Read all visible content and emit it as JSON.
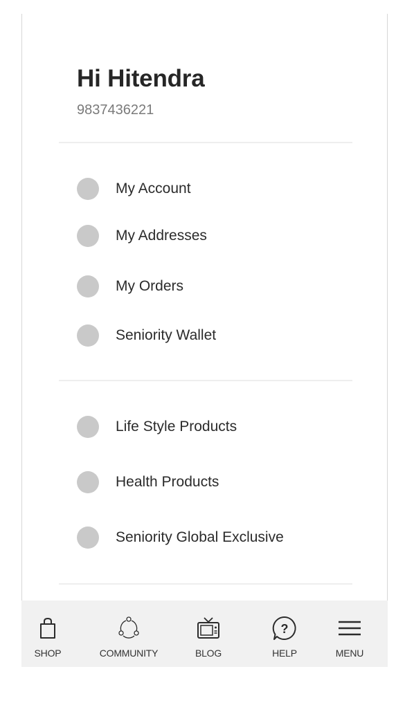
{
  "header": {
    "greeting": "Hi Hitendra",
    "phone": "9837436221"
  },
  "account_menu": [
    {
      "label": "My Account"
    },
    {
      "label": "My Addresses"
    },
    {
      "label": "My Orders"
    },
    {
      "label": "Seniority Wallet"
    }
  ],
  "category_menu": [
    {
      "label": "Life Style Products"
    },
    {
      "label": "Health Products"
    },
    {
      "label": "Seniority Global Exclusive"
    }
  ],
  "bottom_nav": [
    {
      "label": "SHOP",
      "icon": "shopping-bag-icon"
    },
    {
      "label": "COMMUNITY",
      "icon": "community-icon"
    },
    {
      "label": "BLOG",
      "icon": "tv-icon"
    },
    {
      "label": "HELP",
      "icon": "help-icon"
    },
    {
      "label": "MENU",
      "icon": "hamburger-menu-icon"
    }
  ],
  "colors": {
    "dot": "#c9c9c9",
    "text": "#2b2b2b",
    "nav_background": "#f1f1f1"
  }
}
